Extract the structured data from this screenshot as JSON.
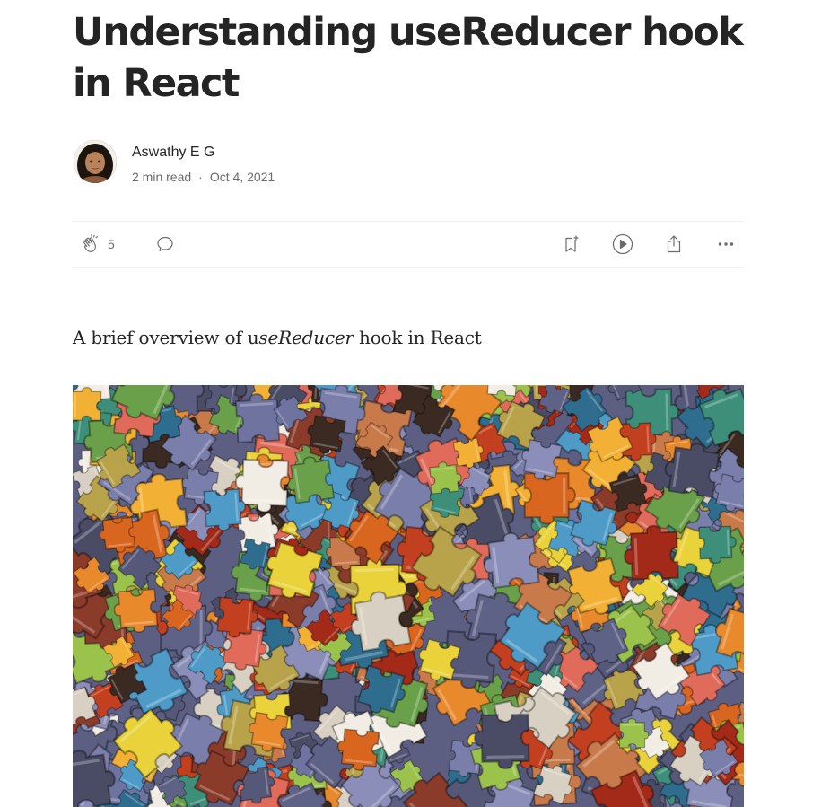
{
  "article": {
    "title": "Understanding useReducer hook in React",
    "subtitle_prefix": "A brief overview of u",
    "subtitle_em": "seReducer",
    "subtitle_suffix": " hook in React"
  },
  "author": {
    "name": "Aswathy E G",
    "read_time": "2 min read",
    "separator": "·",
    "date": "Oct 4, 2021"
  },
  "actions": {
    "clap_count": "5",
    "icons": [
      "clap-icon",
      "comment-icon",
      "bookmark-add-icon",
      "play-icon",
      "share-icon",
      "more-icon"
    ]
  },
  "colors": {
    "text": "#242424",
    "muted": "#6b6b6b",
    "divider": "#f0f0f0"
  }
}
